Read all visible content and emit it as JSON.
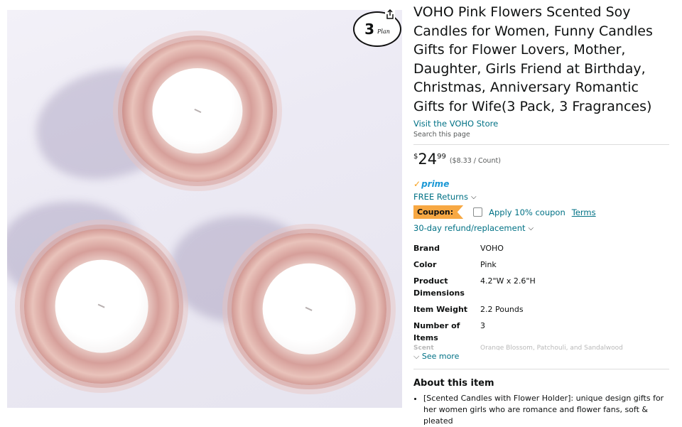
{
  "badge": {
    "number": "3",
    "sub": "Plan"
  },
  "product": {
    "title": "VOHO Pink Flowers Scented Soy Candles for Women, Funny Candles Gifts for Flower Lovers, Mother, Daughter, Girls Friend at Birthday, Christmas, Anniversary Romantic Gifts for Wife(3 Pack, 3 Fragrances)",
    "store_link": "Visit the VOHO Store",
    "search_page": "Search this page"
  },
  "price": {
    "currency": "$",
    "whole": "24",
    "fraction": "99",
    "unit_price": "($8.33 / Count)"
  },
  "prime": {
    "label": "prime"
  },
  "returns": {
    "label": "FREE Returns"
  },
  "coupon": {
    "tag": "Coupon:",
    "apply_label": "Apply 10% coupon",
    "terms": "Terms"
  },
  "refund": {
    "label": "30-day refund/replacement"
  },
  "specs": [
    {
      "key": "Brand",
      "value": "VOHO"
    },
    {
      "key": "Color",
      "value": "Pink"
    },
    {
      "key": "Product Dimensions",
      "value": "4.2\"W x 2.6\"H"
    },
    {
      "key": "Item Weight",
      "value": "2.2 Pounds"
    },
    {
      "key": "Number of Items",
      "value": "3"
    }
  ],
  "spec_partial": {
    "key": "Scent",
    "value": "Orange Blossom, Patchouli, and Sandalwood"
  },
  "see_more": "See more",
  "about": {
    "heading": "About this item",
    "bullets": [
      "[Scented Candles with Flower Holder]: unique design gifts for her women girls who are romance and flower fans, soft & pleated"
    ]
  }
}
